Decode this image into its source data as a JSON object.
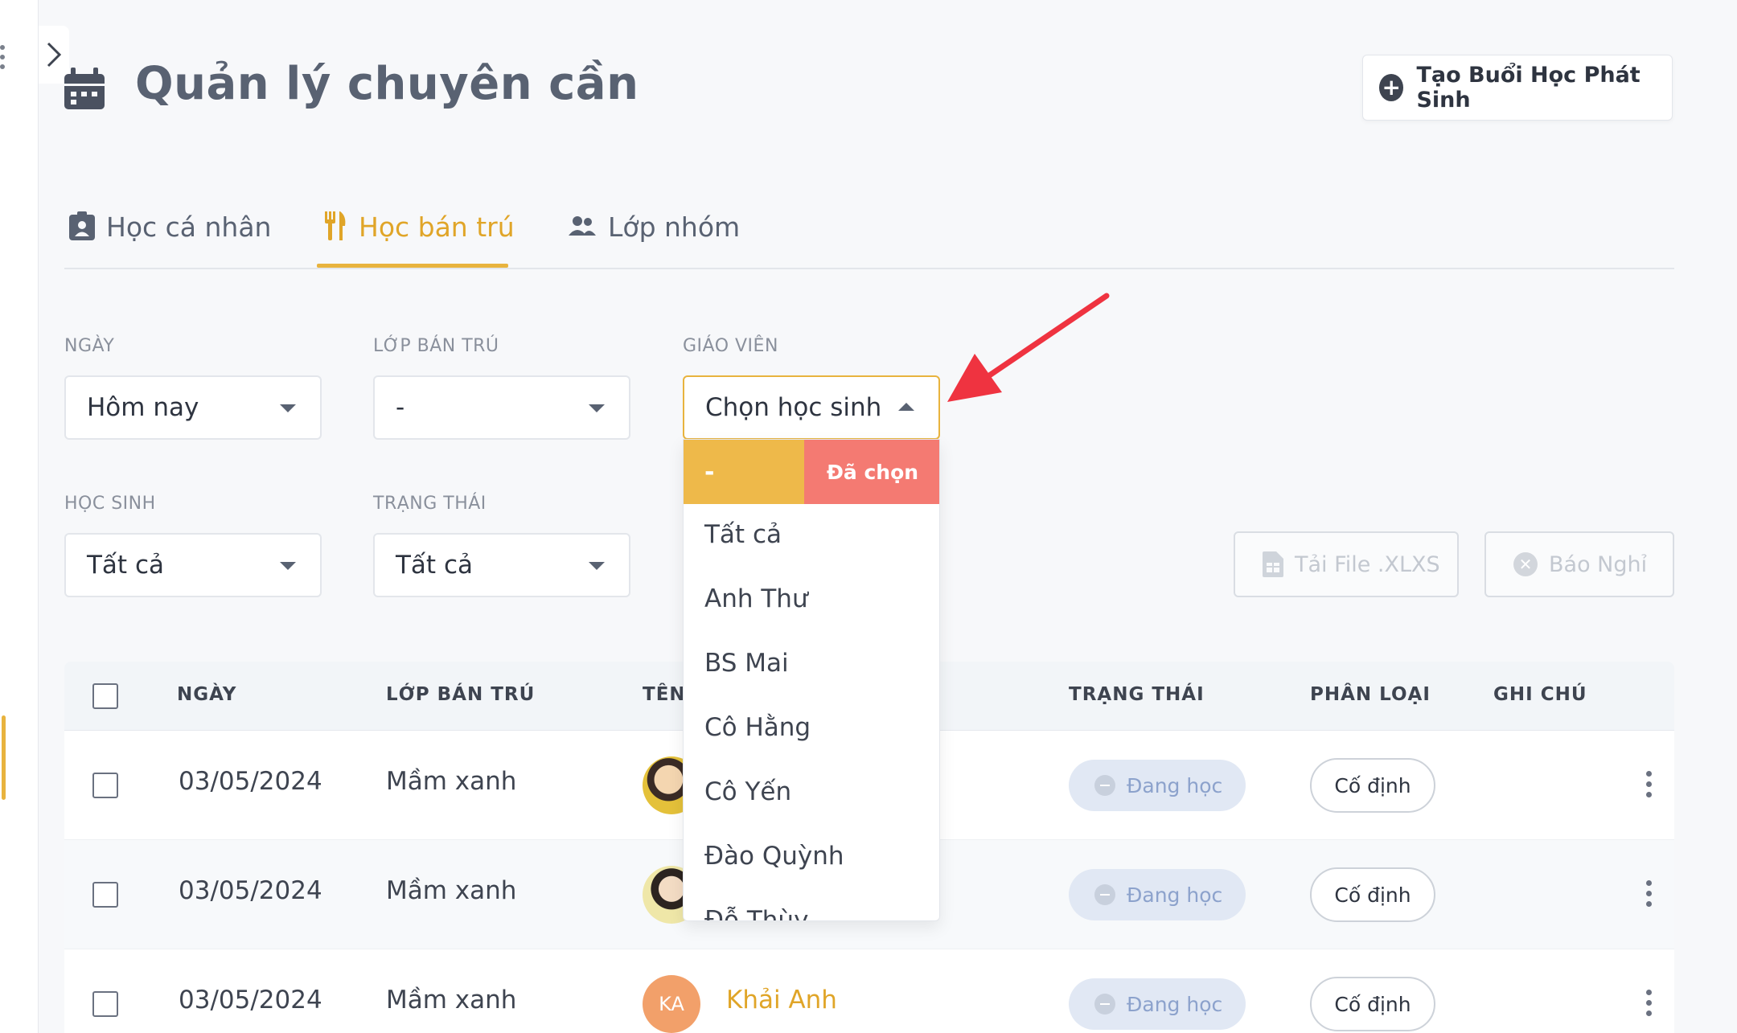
{
  "page": {
    "title": "Quản lý chuyên cần",
    "create_button": "Tạo Buổi Học Phát Sinh"
  },
  "tabs": [
    {
      "label": "Học cá nhân",
      "icon": "badge-icon",
      "active": false
    },
    {
      "label": "Học bán trú",
      "icon": "fork-knife-icon",
      "active": true
    },
    {
      "label": "Lớp nhóm",
      "icon": "group-icon",
      "active": false
    }
  ],
  "filters": {
    "date": {
      "label": "NGÀY",
      "value": "Hôm nay"
    },
    "class": {
      "label": "LỚP BÁN TRÚ",
      "value": "-"
    },
    "teacher": {
      "label": "GIÁO VIÊN",
      "value": "Chọn học sinh",
      "open": true
    },
    "student": {
      "label": "HỌC SINH",
      "value": "Tất cả"
    },
    "status": {
      "label": "TRẠNG THÁI",
      "value": "Tất cả"
    }
  },
  "actions": {
    "download": "Tải File .XLXS",
    "report_absence": "Báo Nghỉ"
  },
  "dropdown": {
    "selected_value": "-",
    "selected_tag": "Đã chọn",
    "options": [
      "Tất cả",
      "Anh Thư",
      "BS Mai",
      "Cô Hằng",
      "Cô Yến",
      "Đào Quỳnh",
      "Đỗ Thùy"
    ]
  },
  "table": {
    "headers": [
      "NGÀY",
      "LỚP BÁN TRÚ",
      "TÊN",
      "TRẠNG THÁI",
      "PHÂN LOẠI",
      "GHI CHÚ"
    ],
    "rows": [
      {
        "date": "03/05/2024",
        "class": "Mầm xanh",
        "avatar": "photo",
        "name": "",
        "status": "Đang học",
        "type": "Cố định"
      },
      {
        "date": "03/05/2024",
        "class": "Mầm xanh",
        "avatar": "photo",
        "name": "",
        "status": "Đang học",
        "type": "Cố định"
      },
      {
        "date": "03/05/2024",
        "class": "Mầm xanh",
        "avatar": "KA",
        "name": "Khải Anh",
        "status": "Đang học",
        "type": "Cố định"
      }
    ]
  },
  "colors": {
    "accent": "#e8b33e",
    "selected_tag": "#f47a72",
    "annotation_arrow": "#ef3340"
  }
}
